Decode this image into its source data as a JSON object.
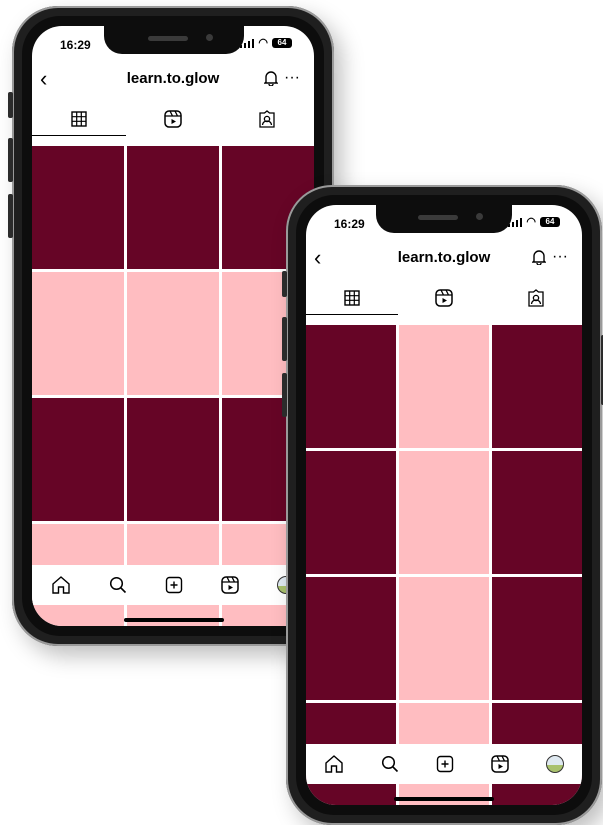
{
  "colors": {
    "maroon": "#660526",
    "pink": "#ffbdc1"
  },
  "status": {
    "time": "16:29",
    "battery": "64"
  },
  "profile": {
    "username": "learn.to.glow"
  },
  "icons": {
    "back": "‹",
    "bell": "bell-icon",
    "more": "···",
    "grid": "grid-icon",
    "reels": "reels-icon",
    "tagged": "tagged-icon",
    "home": "home-icon",
    "search": "search-icon",
    "add": "add-icon",
    "reels_nav": "reels-icon",
    "profile": "avatar"
  },
  "phone_left": {
    "grid": [
      [
        "maroon",
        "maroon",
        "maroon"
      ],
      [
        "pink",
        "pink",
        "pink"
      ],
      [
        "maroon",
        "maroon",
        "maroon"
      ],
      [
        "pink",
        "pink",
        "pink"
      ]
    ]
  },
  "phone_right": {
    "grid": [
      [
        "maroon",
        "pink",
        "maroon"
      ],
      [
        "maroon",
        "pink",
        "maroon"
      ],
      [
        "maroon",
        "pink",
        "maroon"
      ],
      [
        "maroon",
        "pink",
        "maroon"
      ]
    ]
  }
}
